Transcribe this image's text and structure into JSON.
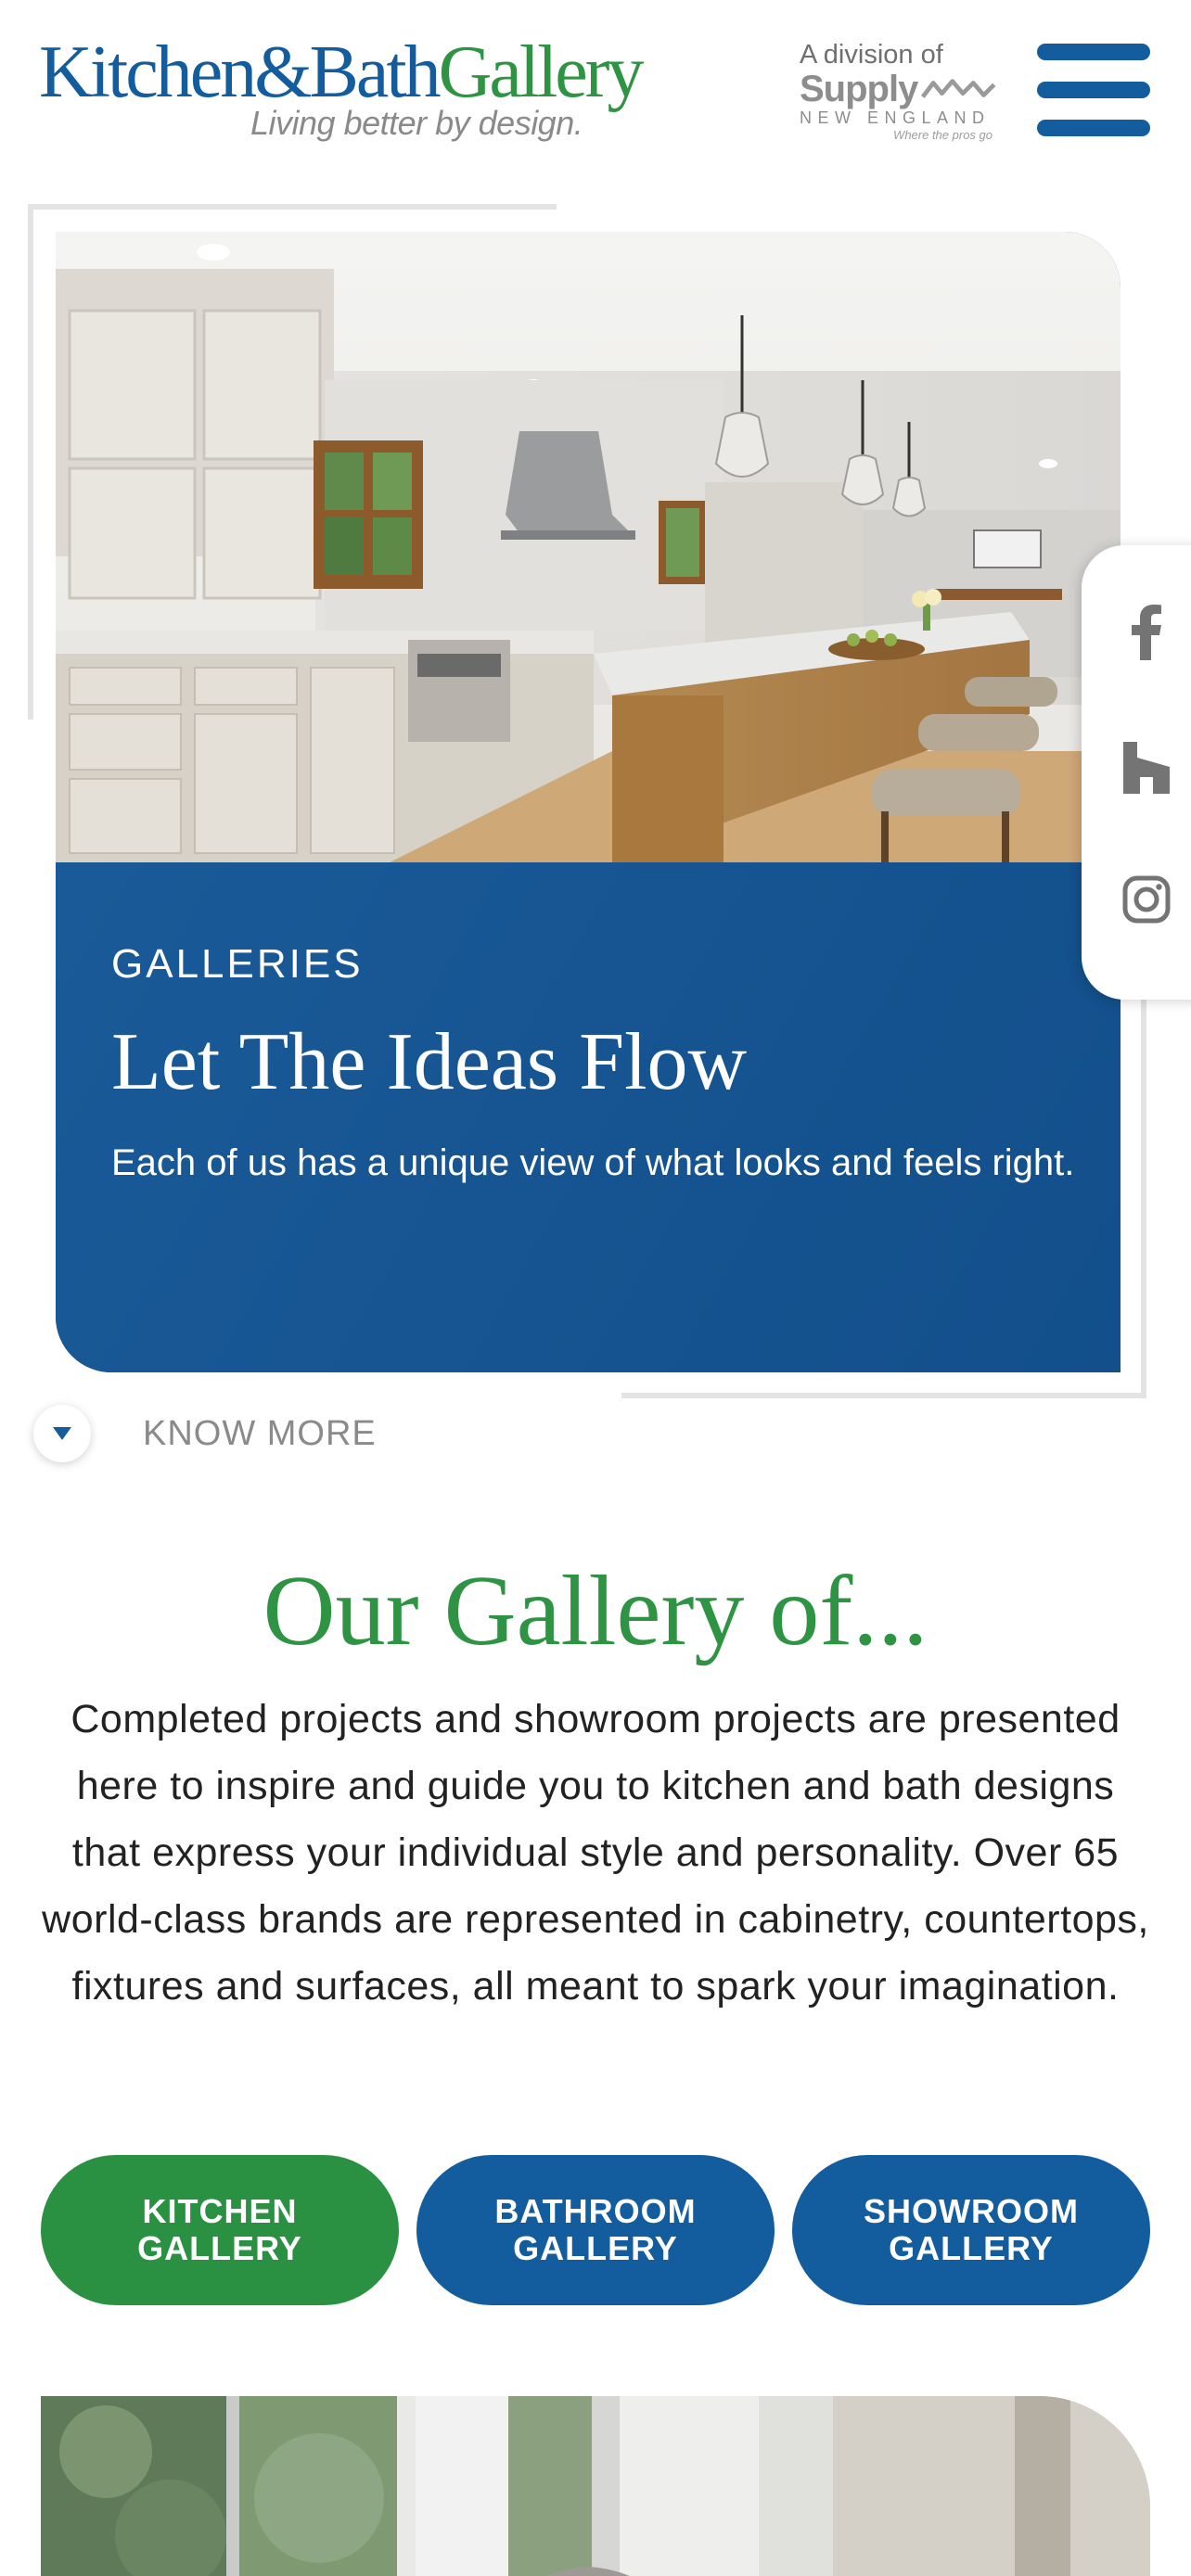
{
  "header": {
    "logo_kitchen_bath": "Kitchen&Bath",
    "logo_gallery": "Gallery",
    "logo_tagline": "Living better by design.",
    "division_label": "A division of",
    "division_supply": "Supply",
    "division_new_england": "NEW ENGLAND",
    "division_tagline": "Where the pros go",
    "menu_icon": "hamburger-menu-icon"
  },
  "hero": {
    "eyebrow": "GALLERIES",
    "title": "Let The Ideas Flow",
    "description": "Each of us has a unique view of what looks and feels right.",
    "know_more": "KNOW MORE"
  },
  "social": {
    "icons": [
      "facebook-icon",
      "houzz-icon",
      "instagram-icon"
    ]
  },
  "gallery": {
    "title": "Our Gallery of...",
    "description": "Completed projects and showroom projects are presented here to inspire and guide you to kitchen and bath designs that express your individual style and personality. Over 65 world-class brands are represented in cabinetry, countertops, fixtures and surfaces, all meant to spark your imagination.",
    "buttons": {
      "kitchen": "KITCHEN GALLERY",
      "bathroom": "BATHROOM GALLERY",
      "showroom": "SHOWROOM GALLERY"
    }
  },
  "colors": {
    "brand_blue": "#135c9d",
    "brand_green": "#2e9444",
    "hero_blue": "#155490"
  }
}
